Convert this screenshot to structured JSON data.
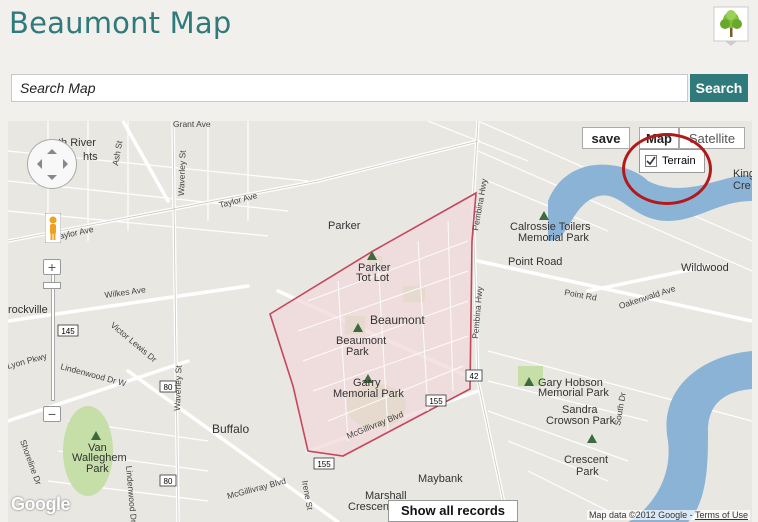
{
  "header": {
    "title": "Beaumont Map",
    "logo_icon": "tree-icon"
  },
  "search": {
    "placeholder": "Search Map",
    "value": "",
    "button_label": "Search"
  },
  "map": {
    "labels": {
      "north_river_heights": "th River",
      "heights2": "hts",
      "grant_ave": "Grant Ave",
      "ash_st": "Ash St",
      "taylor_ave": "Taylor Ave",
      "taylor_ave2": "aylor Ave",
      "parker": "Parker",
      "parker_tot_lot": "Parker",
      "parker_tot_lot2": "Tot Lot",
      "wilkes_ave": "Wilkes Ave",
      "rockville": "rockville",
      "victor_lewis": "Victor Lewis Dr",
      "lyon_pkwy": "Lyon Pkwy",
      "lindenwood": "Lindenwood Dr W",
      "beaumont": "Beaumont",
      "beaumont_park": "Beaumont",
      "beaumont_park2": "Park",
      "garry_memorial_park": "Garry",
      "garry_memorial_park2": "Memorial Park",
      "buffalo": "Buffalo",
      "waverley_st": "Waverley St",
      "waverley_st2": "Waverley St",
      "pembina_hwy": "Pembina Hwy",
      "pembina_hwy2": "Pembina Hwy",
      "mcgillivray": "McGillivray Blvd",
      "mcgillivray2": "McGillivray Blvd",
      "walleghem": "Van",
      "walleghem2": "Walleghem",
      "walleghem3": "Park",
      "shoreline": "Shoreline Dr",
      "lindenwood_dr_e": "Lindenwood Dr E",
      "irene_st": "Irene St",
      "maybank": "Maybank",
      "marshall": "Marshall",
      "crescent": "Crescent",
      "calrossie": "Calrossie Toilers",
      "calrossie2": "Memorial Park",
      "point_road": "Point Road",
      "point_rd": "Point Rd",
      "oakenwald": "Oakenwald Ave",
      "wildwood": "Wildwood",
      "garry_hobson": "Gary Hobson",
      "garry_hobson2": "Memorial Park",
      "sandra": "Sandra",
      "sandra2": "Crowson Park",
      "crescent_park": "Crescent",
      "crescent_park2": "Park",
      "south_dr": "South Dr",
      "king": "King",
      "king2": "Cre",
      "hwy_145": "145",
      "hwy_80": "80",
      "hwy_80b": "80",
      "hwy_155": "155",
      "hwy_155b": "155",
      "hwy_42": "42"
    },
    "controls": {
      "zoom_in": "+",
      "zoom_out": "−"
    },
    "buttons": {
      "save": "save",
      "map": "Map",
      "satellite": "Satellite",
      "terrain": "Terrain",
      "show_all": "Show all records"
    },
    "terrain_checked": true,
    "google_logo": "Google",
    "attribution": "Map data ©2012 Google - ",
    "terms": "Terms of Use"
  },
  "colors": {
    "accent": "#2f7a7a",
    "river": "#8bb3d6",
    "park": "#c6dea8",
    "highlight": "#b11a1a",
    "area": "#f0d8db"
  }
}
